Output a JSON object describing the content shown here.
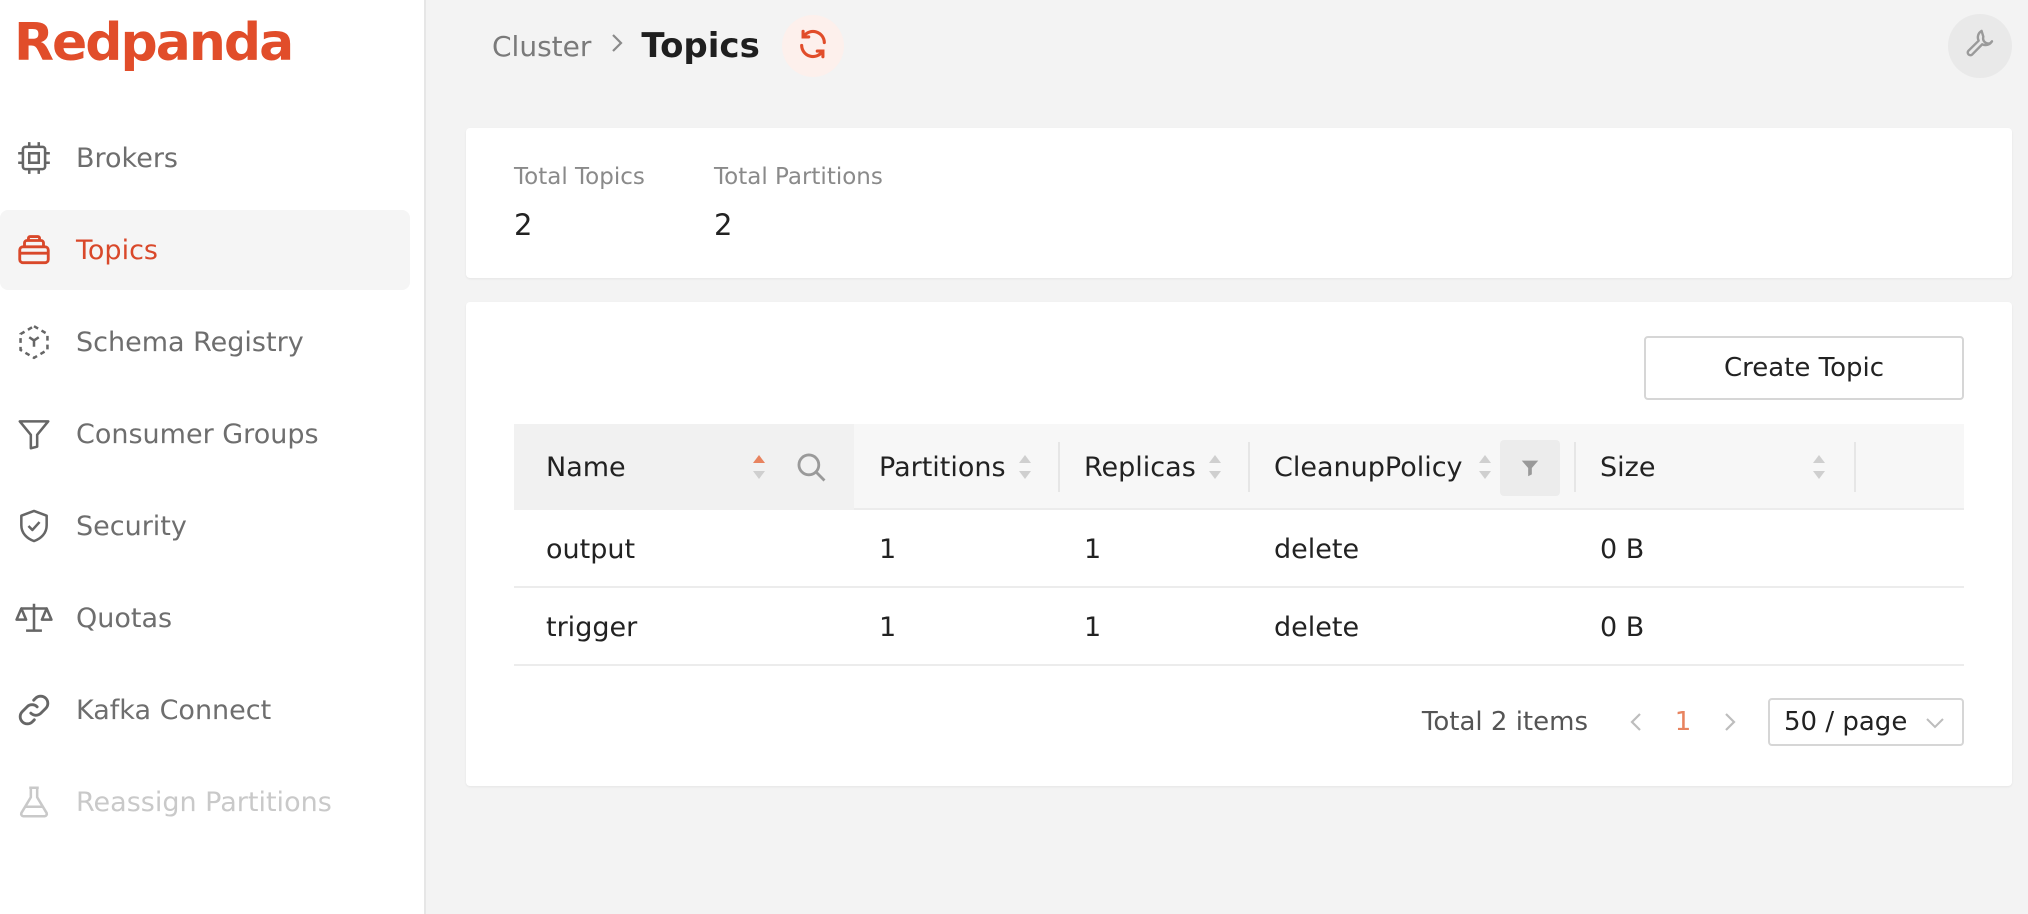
{
  "brand": {
    "name": "Redpanda",
    "color": "#e14d2a"
  },
  "sidebar": {
    "items": [
      {
        "label": "Brokers",
        "icon": "chip-icon",
        "active": false,
        "disabled": false
      },
      {
        "label": "Topics",
        "icon": "stack-icon",
        "active": true,
        "disabled": false
      },
      {
        "label": "Schema Registry",
        "icon": "schema-icon",
        "active": false,
        "disabled": false
      },
      {
        "label": "Consumer Groups",
        "icon": "funnel-icon",
        "active": false,
        "disabled": false
      },
      {
        "label": "Security",
        "icon": "shield-check-icon",
        "active": false,
        "disabled": false
      },
      {
        "label": "Quotas",
        "icon": "scale-icon",
        "active": false,
        "disabled": false
      },
      {
        "label": "Kafka Connect",
        "icon": "link-icon",
        "active": false,
        "disabled": false
      },
      {
        "label": "Reassign Partitions",
        "icon": "flask-icon",
        "active": false,
        "disabled": true
      }
    ]
  },
  "header": {
    "breadcrumb": "Cluster",
    "title": "Topics",
    "refresh_icon": "refresh-icon",
    "settings_icon": "wrench-icon"
  },
  "stats": {
    "total_topics_label": "Total Topics",
    "total_topics_value": "2",
    "total_partitions_label": "Total Partitions",
    "total_partitions_value": "2"
  },
  "toolbar": {
    "create_label": "Create Topic"
  },
  "table": {
    "columns": [
      "Name",
      "Partitions",
      "Replicas",
      "CleanupPolicy",
      "Size"
    ],
    "rows": [
      {
        "name": "output",
        "partitions": "1",
        "replicas": "1",
        "cleanup": "delete",
        "size": "0 B"
      },
      {
        "name": "trigger",
        "partitions": "1",
        "replicas": "1",
        "cleanup": "delete",
        "size": "0 B"
      }
    ]
  },
  "pagination": {
    "total": "Total 2 items",
    "current": "1",
    "page_size": "50 / page"
  },
  "colors": {
    "accent": "#e14d2a",
    "active_text": "#d9482a",
    "page_current": "#e8835f"
  }
}
